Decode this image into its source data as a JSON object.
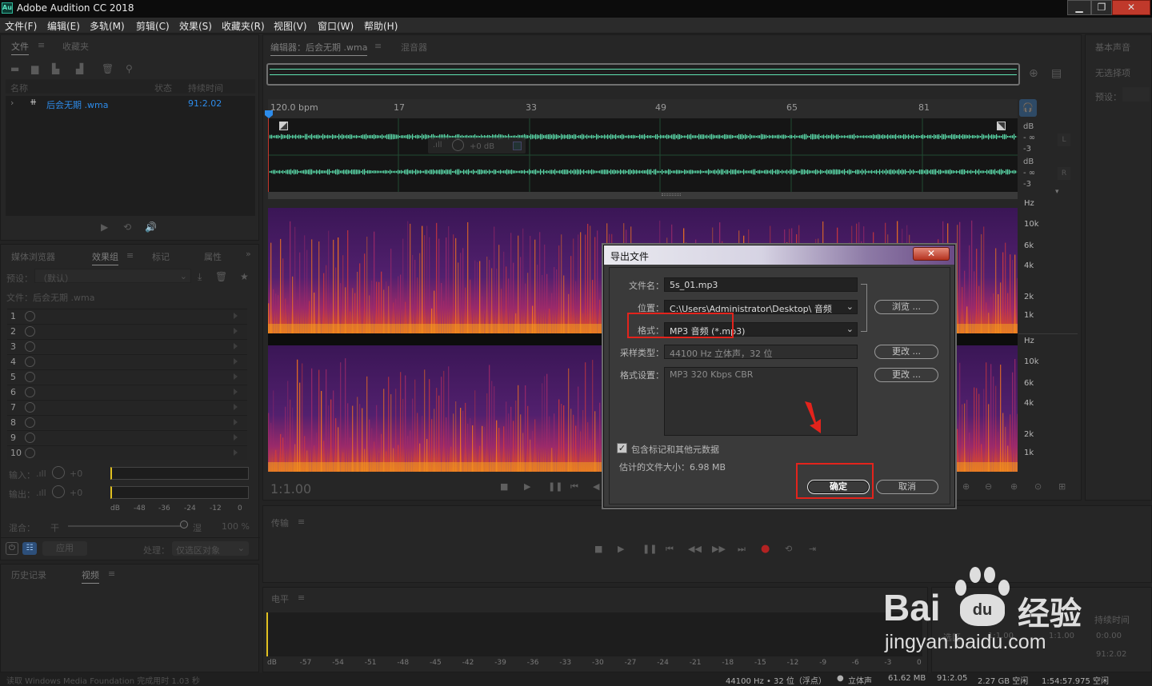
{
  "app": {
    "title": "Adobe Audition CC 2018"
  },
  "menu": [
    "文件(F)",
    "编辑(E)",
    "多轨(M)",
    "剪辑(C)",
    "效果(S)",
    "收藏夹(R)",
    "视图(V)",
    "窗口(W)",
    "帮助(H)"
  ],
  "files_panel": {
    "tabs": [
      "文件",
      "收藏夹"
    ],
    "col_name": "名称",
    "col_status": "状态",
    "col_duration": "持续时间",
    "file_name": "后会无期 .wma",
    "file_duration": "91:2.02"
  },
  "effects_panel": {
    "tabs": [
      "媒体浏览器",
      "效果组",
      "标记",
      "属性"
    ],
    "preset_label": "预设：",
    "preset_value": "（默认）",
    "file_label": "文件：后会无期 .wma",
    "slots": [
      "1",
      "2",
      "3",
      "4",
      "5",
      "6",
      "7",
      "8",
      "9",
      "10"
    ],
    "input_label": "输入：",
    "output_label": "输出：",
    "input_db": "+0",
    "output_db": "+0",
    "meter_scale": [
      "dB",
      "-48",
      "-36",
      "-24",
      "-12",
      "0"
    ],
    "mix_label": "混合：",
    "dry_label": "干",
    "wet_label": "湿",
    "mix_value": "100 %",
    "apply_label": "应用",
    "process_label": "处理：",
    "process_value": "仅选区对象"
  },
  "history_panel": {
    "tabs": [
      "历史记录",
      "视频"
    ]
  },
  "editor": {
    "tab_editor": "编辑器：后会无期 .wma",
    "tab_mixer": "混音器",
    "bpm": "120.0 bpm",
    "bars": [
      "17",
      "33",
      "49",
      "65",
      "81"
    ],
    "hud_db": "+0 dB",
    "db_labels": [
      "dB",
      "- ∞",
      "-3",
      "dB",
      "- ∞",
      "-3"
    ],
    "channels": [
      "L",
      "R"
    ],
    "hz_labels_top": [
      "Hz",
      "10k",
      "6k",
      "4k",
      "2k",
      "1k"
    ],
    "hz_labels_bottom": [
      "Hz",
      "10k",
      "6k",
      "4k",
      "2k",
      "1k"
    ],
    "time": "1:1.00"
  },
  "right_panel": {
    "title": "基本声音",
    "no_selection": "无选择项",
    "preset_label": "预设："
  },
  "transport_panel": {
    "title": "传输"
  },
  "levels_panel": {
    "title": "电平",
    "scale": [
      "dB",
      "-57",
      "-54",
      "-51",
      "-48",
      "-45",
      "-42",
      "-39",
      "-36",
      "-33",
      "-30",
      "-27",
      "-24",
      "-21",
      "-18",
      "-15",
      "-12",
      "-9",
      "-6",
      "-3",
      "0"
    ]
  },
  "selection_panel": {
    "duration_label": "持续时间",
    "selection_label": "选区",
    "start": "1:1.00",
    "end": "1:1.00",
    "duration": "0:0.00",
    "view_duration": "91:2.02"
  },
  "statusbar": {
    "message": "读取 Windows Media Foundation 完成用时 1.03 秒",
    "format": "44100 Hz • 32 位（浮点）",
    "channels": "立体声",
    "size": "61.62 MB",
    "duration": "91:2.05",
    "free": "2.27 GB 空闲",
    "free_time": "1:54:57.975 空闲"
  },
  "dialog": {
    "title": "导出文件",
    "filename_label": "文件名：",
    "filename": "5s_01.mp3",
    "location_label": "位置：",
    "location": "C:\\Users\\Administrator\\Desktop\\ 音频",
    "browse": "浏览 ...",
    "format_label": "格式：",
    "format": "MP3 音频 (*.mp3)",
    "sample_label": "采样类型：",
    "sample": "44100 Hz 立体声，32 位",
    "change": "更改 ...",
    "settings_label": "格式设置：",
    "settings": "MP3 320 Kbps CBR",
    "include_markers": "包含标记和其他元数据",
    "estimated_size": "估计的文件大小：6.98 MB",
    "ok": "确定",
    "cancel": "取消"
  },
  "watermark": {
    "brand": "Bai",
    "du": "du",
    "jingyan": "经验",
    "url": "jingyan.baidu.com"
  },
  "colors": {
    "accent": "#2d8ceb",
    "waveform": "#5fe4b3",
    "highlight": "#e3231c"
  }
}
